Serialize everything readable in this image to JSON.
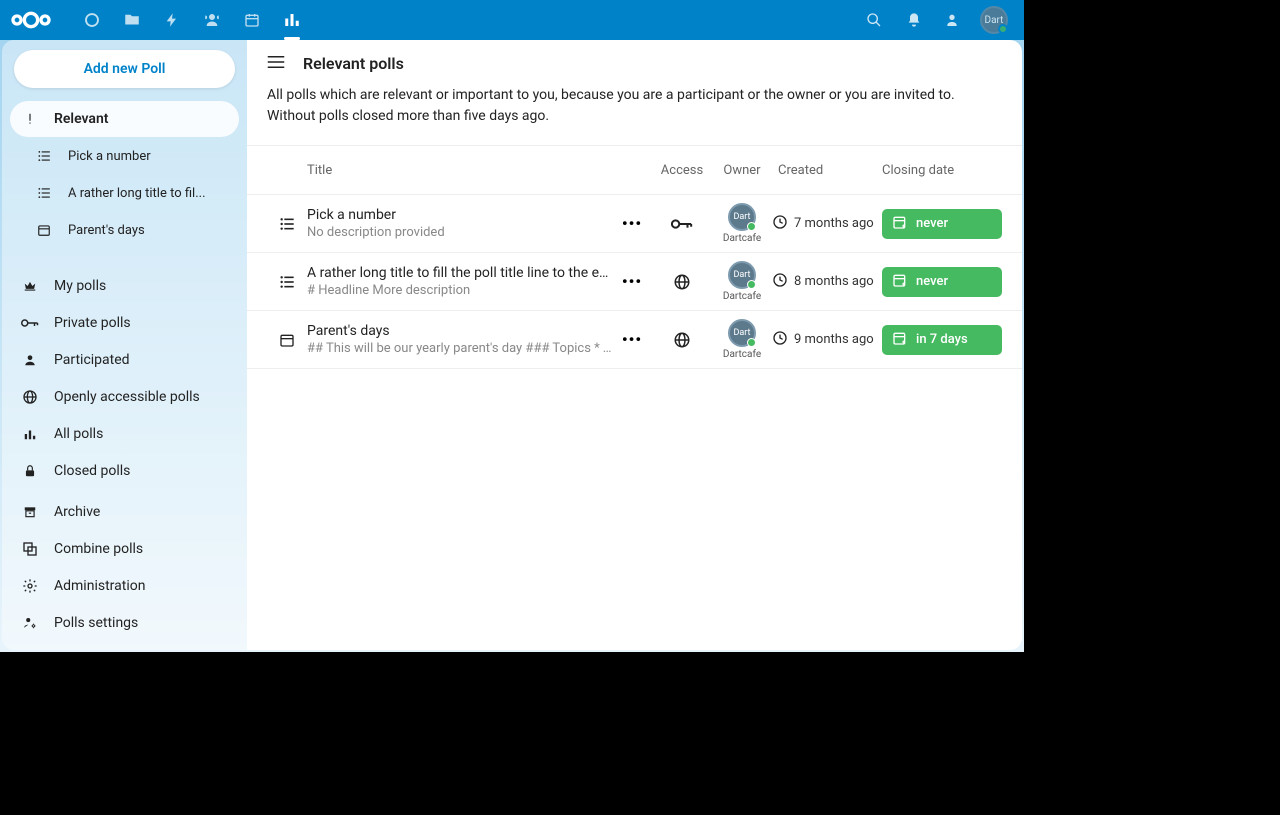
{
  "sidebar": {
    "add_button": "Add new Poll",
    "items": [
      {
        "label": "Relevant",
        "icon": "important"
      },
      {
        "label": "Pick a number",
        "icon": "list",
        "sub": true
      },
      {
        "label": "A rather long title to fil...",
        "icon": "list",
        "sub": true
      },
      {
        "label": "Parent's days",
        "icon": "calendar",
        "sub": true
      },
      {
        "label": "My polls",
        "icon": "crown"
      },
      {
        "label": "Private polls",
        "icon": "key"
      },
      {
        "label": "Participated",
        "icon": "person"
      },
      {
        "label": "Openly accessible polls",
        "icon": "globe"
      },
      {
        "label": "All polls",
        "icon": "bars"
      },
      {
        "label": "Closed polls",
        "icon": "lock"
      }
    ],
    "bottom": [
      {
        "label": "Archive",
        "icon": "archive"
      },
      {
        "label": "Combine polls",
        "icon": "combine"
      },
      {
        "label": "Administration",
        "icon": "gear"
      },
      {
        "label": "Polls settings",
        "icon": "person-gear"
      }
    ]
  },
  "header": {
    "title": "Relevant polls",
    "description": "All polls which are relevant or important to you, because you are a participant or the owner or you are invited to. Without polls closed more than five days ago."
  },
  "table": {
    "headers": {
      "title": "Title",
      "access": "Access",
      "owner": "Owner",
      "created": "Created",
      "closing": "Closing date"
    }
  },
  "polls": [
    {
      "type": "list",
      "title": "Pick a number",
      "desc": "No description provided",
      "access": "key",
      "owner": "Dartcafe",
      "created": "7 months ago",
      "closing": "never"
    },
    {
      "type": "list",
      "title": "A rather long title to fill the poll title line to the end and to...",
      "desc": "# Headline More description",
      "access": "globe",
      "owner": "Dartcafe",
      "created": "8 months ago",
      "closing": "never"
    },
    {
      "type": "calendar",
      "title": "Parent's days",
      "desc": "## This will be our yearly parent's day ### Topics * Talk ...",
      "access": "globe",
      "owner": "Dartcafe",
      "created": "9 months ago",
      "closing": "in 7 days"
    }
  ],
  "user": {
    "name": "Dart",
    "status": "online"
  }
}
